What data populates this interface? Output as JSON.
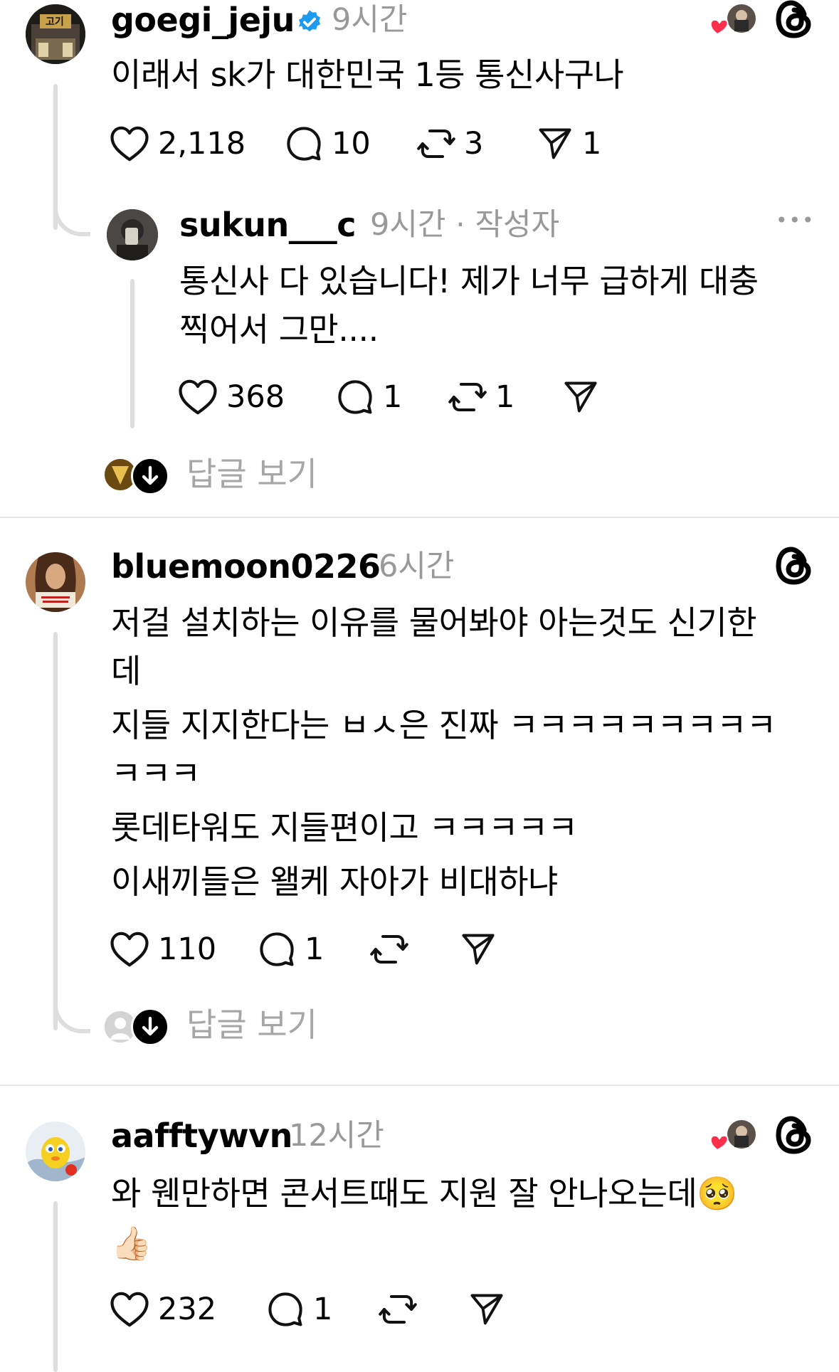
{
  "comments": [
    {
      "username": "goegi_jeju",
      "verified": true,
      "time": "9시간",
      "text": [
        "이래서 sk가 대한민국 1등 통신사구나"
      ],
      "actions": {
        "likes": "2,118",
        "replies": "10",
        "reposts": "3",
        "shares": "1"
      },
      "avatar_sign": "고기"
    },
    {
      "username": "sukun___c",
      "time": "9시간 · 작성자",
      "text": [
        "통신사 다 있습니다! 제가 너무 급하게 대충",
        "찍어서 그만...."
      ],
      "actions": {
        "likes": "368",
        "replies": "1",
        "reposts": "1",
        "shares": ""
      },
      "more": "•••"
    },
    {
      "username": "bluemoon0226",
      "time": "6시간",
      "text": [
        "저걸 설치하는 이유를 물어봐야 아는것도 신기한",
        "데",
        "지들 지지한다는 ㅂㅅ은 진짜 ㅋㅋㅋㅋㅋㅋㅋㅋㅋ",
        "ㅋㅋㅋ",
        "롯데타워도 지들편이고 ㅋㅋㅋㅋㅋ",
        "이새끼들은 왤케 자아가 비대하냐"
      ],
      "actions": {
        "likes": "110",
        "replies": "1",
        "reposts": "",
        "shares": ""
      }
    },
    {
      "username": "aafftywvn",
      "time": "12시간",
      "text": [
        "와 웬만하면 콘서트때도 지원 잘 안나오는데🥺",
        "👍🏻"
      ],
      "actions": {
        "likes": "232",
        "replies": "1",
        "reposts": "",
        "shares": ""
      }
    }
  ],
  "view_replies_label": "답글 보기",
  "colors": {
    "verified": "#1d9bf0",
    "heart": "#ff2e4d",
    "muted": "#999999",
    "line": "#dedede"
  }
}
